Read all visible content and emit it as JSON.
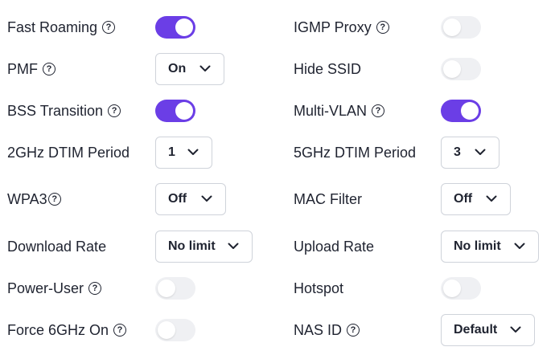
{
  "left": {
    "fast_roaming": "Fast Roaming",
    "pmf": "PMF",
    "bss_transition": "BSS Transition",
    "dtim_2ghz": "2GHz DTIM Period",
    "wpa3": "WPA3",
    "download_rate": "Download Rate",
    "power_user": "Power-User",
    "force_6ghz": "Force 6GHz On"
  },
  "right": {
    "igmp_proxy": "IGMP Proxy",
    "hide_ssid": "Hide SSID",
    "multi_vlan": "Multi-VLAN",
    "dtim_5ghz": "5GHz DTIM Period",
    "mac_filter": "MAC Filter",
    "upload_rate": "Upload Rate",
    "hotspot": "Hotspot",
    "nas_id": "NAS ID"
  },
  "values": {
    "pmf": "On",
    "dtim_2ghz": "1",
    "wpa3": "Off",
    "download_rate": "No limit",
    "dtim_5ghz": "3",
    "mac_filter": "Off",
    "upload_rate": "No limit",
    "nas_id": "Default"
  },
  "toggles": {
    "fast_roaming": true,
    "bss_transition": true,
    "power_user": false,
    "force_6ghz": false,
    "igmp_proxy": false,
    "hide_ssid": false,
    "multi_vlan": true,
    "hotspot": false
  },
  "help_glyph": "?",
  "colors": {
    "accent": "#6b3ee6",
    "toggle_off": "#eff0f3"
  },
  "icons": {
    "help": "question-circle-icon",
    "dropdown": "chevron-down-icon"
  }
}
